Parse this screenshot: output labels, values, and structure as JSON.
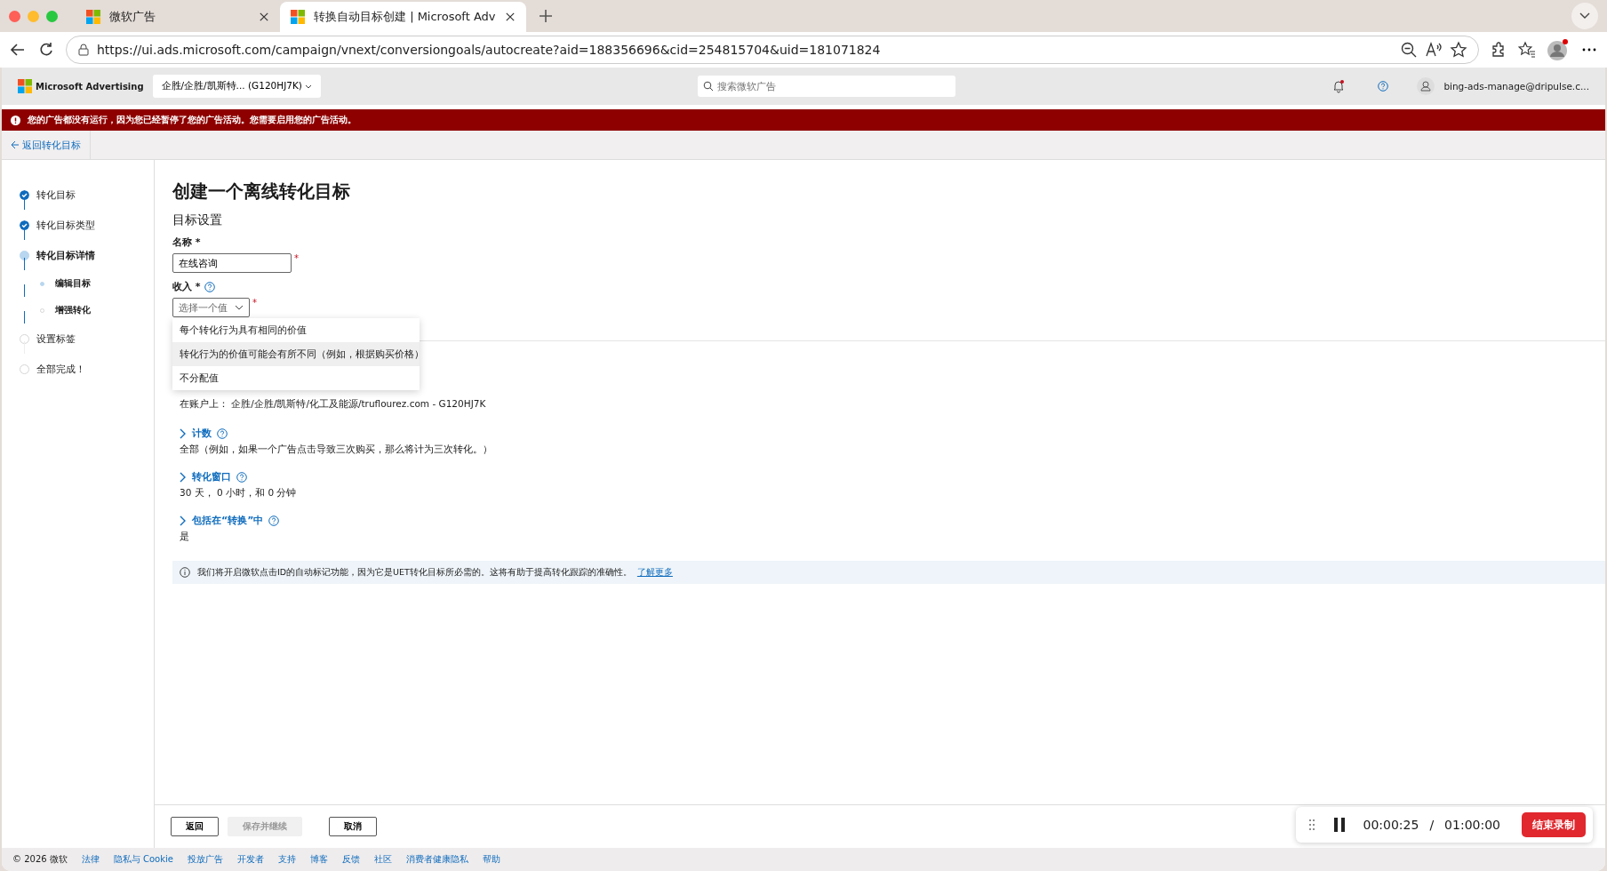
{
  "browser": {
    "tabs": [
      {
        "title": "微软广告",
        "selected": false
      },
      {
        "title": "转换自动目标创建 | Microsoft Adv",
        "selected": true
      }
    ],
    "url": "https://ui.ads.microsoft.com/campaign/vnext/conversiongoals/autocreate?aid=188356696&cid=254815704&uid=181071824"
  },
  "header": {
    "brand": "Microsoft Advertising",
    "account": "企胜/企胜/凯斯特... (G120HJ7K)",
    "search": {
      "placeholder": "搜索微软广告"
    },
    "user": "bing-ads-manage@dripulse.c..."
  },
  "banner": "您的广告都没有运行，因为您已经暂停了您的广告活动。您需要启用您的广告活动。",
  "back_link": "返回转化目标",
  "steps": [
    {
      "label": "转化目标",
      "done": true,
      "current": false
    },
    {
      "label": "转化目标类型",
      "done": true,
      "current": false
    },
    {
      "label": "转化目标详情",
      "done": false,
      "current": true,
      "children": [
        {
          "label": "编辑目标",
          "done": false,
          "current": true
        },
        {
          "label": "增强转化",
          "done": false,
          "current": false
        }
      ]
    },
    {
      "label": "设置标签",
      "done": false,
      "current": false
    },
    {
      "label": "全部完成！",
      "done": false,
      "current": false
    }
  ],
  "page": {
    "title": "创建一个离线转化目标",
    "section": "目标设置",
    "name_field": {
      "label": "名称 *",
      "value": "在线咨询",
      "required_mark": "*"
    },
    "revenue_field": {
      "label": "收入 *",
      "placeholder": "选择一个值",
      "required_mark": "*",
      "options": [
        {
          "label": "每个转化行为具有相同的价值",
          "highlighted": false
        },
        {
          "label": "转化行为的价值可能会有所不同（例如，根据购买价格）",
          "highlighted": true
        },
        {
          "label": "不分配值",
          "highlighted": false
        }
      ]
    },
    "scope_value": "在账户上：  企胜/企胜/凯斯特/化工及能源/truflourez.com - G120HJ7K",
    "settings": [
      {
        "title": "计数",
        "value": "全部（例如，如果一个广告点击导致三次购买，那么将计为三次转化。）"
      },
      {
        "title": "转化窗口",
        "value": "30 天， 0 小时，和 0 分钟"
      },
      {
        "title": "包括在“转换”中",
        "value": "是"
      }
    ],
    "info": {
      "text": "我们将开启微软点击ID的自动标记功能，因为它是UET转化目标所必需的。这将有助于提高转化跟踪的准确性。",
      "link": "了解更多"
    }
  },
  "actions": [
    {
      "label": "返回",
      "disabled": false
    },
    {
      "label": "保存并继续",
      "disabled": true
    },
    {
      "label": "取消",
      "disabled": false
    }
  ],
  "recorder": {
    "elapsed": "00:00:25",
    "separator": "/",
    "limit": "01:00:00",
    "stop": "结束录制"
  },
  "footer": [
    "© 2026 微软",
    "法律",
    "隐私与 Cookie",
    "投放广告",
    "开发者",
    "支持",
    "博客",
    "反馈",
    "社区",
    "消费者健康隐私",
    "帮助"
  ]
}
